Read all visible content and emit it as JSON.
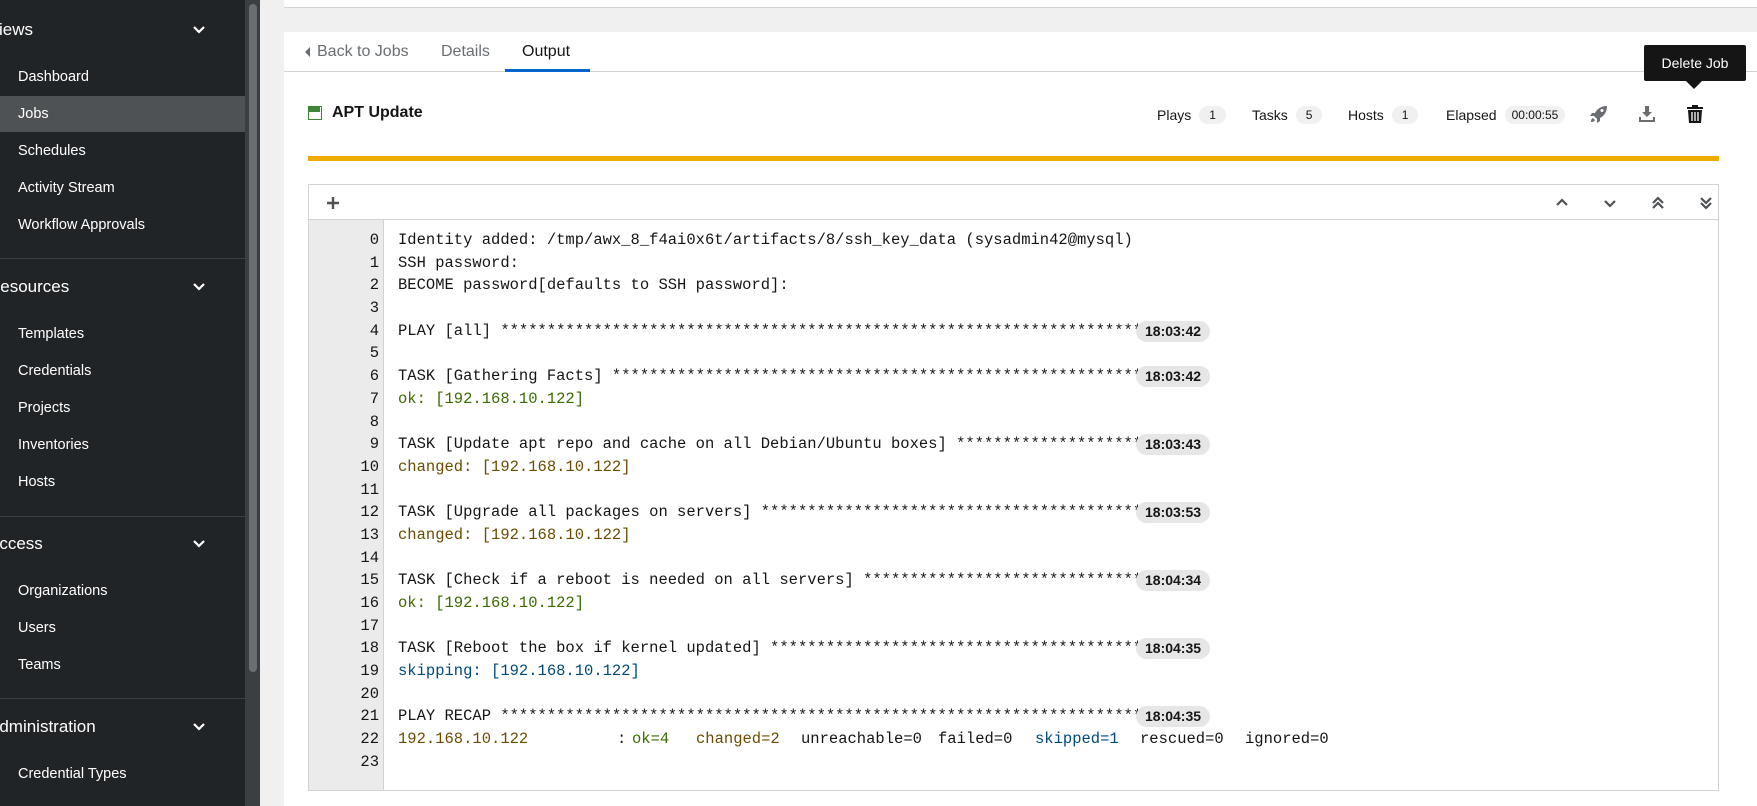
{
  "sidebar": {
    "sections": [
      {
        "title": "Views",
        "items": [
          "Dashboard",
          "Jobs",
          "Schedules",
          "Activity Stream",
          "Workflow Approvals"
        ]
      },
      {
        "title": "Resources",
        "items": [
          "Templates",
          "Credentials",
          "Projects",
          "Inventories",
          "Hosts"
        ]
      },
      {
        "title": "Access",
        "items": [
          "Organizations",
          "Users",
          "Teams"
        ]
      },
      {
        "title": "Administration",
        "items": [
          "Credential Types"
        ]
      }
    ]
  },
  "tabs": {
    "back": "Back to Jobs",
    "details": "Details",
    "output": "Output"
  },
  "tooltip": "Delete Job",
  "job": {
    "title": "APT Update",
    "status_color": "#3e8635",
    "plays_label": "Plays",
    "plays": "1",
    "tasks_label": "Tasks",
    "tasks": "5",
    "hosts_label": "Hosts",
    "hosts": "1",
    "elapsed_label": "Elapsed",
    "elapsed": "00:00:55",
    "progress_color": "#f0ab00",
    "progress_fraction": 1.0
  },
  "output": {
    "lines": [
      {
        "n": "0",
        "text": "Identity added: /tmp/awx_8_f4ai0x6t/artifacts/8/ssh_key_data (sysadmin42@mysql)",
        "kind": "plain",
        "ts": ""
      },
      {
        "n": "1",
        "text": "SSH password:",
        "kind": "plain",
        "ts": ""
      },
      {
        "n": "2",
        "text": "BECOME password[defaults to SSH password]:",
        "kind": "plain",
        "ts": ""
      },
      {
        "n": "3",
        "text": "",
        "kind": "plain",
        "ts": ""
      },
      {
        "n": "4",
        "text": "PLAY [all] *********************************************************************",
        "kind": "plain",
        "ts": "18:03:42"
      },
      {
        "n": "5",
        "text": "",
        "kind": "plain",
        "ts": ""
      },
      {
        "n": "6",
        "text": "TASK [Gathering Facts] *********************************************************",
        "kind": "plain",
        "ts": "18:03:42"
      },
      {
        "n": "7",
        "text": "ok: [192.168.10.122]",
        "kind": "ok",
        "ts": ""
      },
      {
        "n": "8",
        "text": "",
        "kind": "plain",
        "ts": ""
      },
      {
        "n": "9",
        "text": "TASK [Update apt repo and cache on all Debian/Ubuntu boxes] ********************",
        "kind": "plain",
        "ts": "18:03:43"
      },
      {
        "n": "10",
        "text": "changed: [192.168.10.122]",
        "kind": "changed",
        "ts": ""
      },
      {
        "n": "11",
        "text": "",
        "kind": "plain",
        "ts": ""
      },
      {
        "n": "12",
        "text": "TASK [Upgrade all packages on servers] *****************************************",
        "kind": "plain",
        "ts": "18:03:53"
      },
      {
        "n": "13",
        "text": "changed: [192.168.10.122]",
        "kind": "changed",
        "ts": ""
      },
      {
        "n": "14",
        "text": "",
        "kind": "plain",
        "ts": ""
      },
      {
        "n": "15",
        "text": "TASK [Check if a reboot is needed on all servers] ******************************",
        "kind": "plain",
        "ts": "18:04:34"
      },
      {
        "n": "16",
        "text": "ok: [192.168.10.122]",
        "kind": "ok",
        "ts": ""
      },
      {
        "n": "17",
        "text": "",
        "kind": "plain",
        "ts": ""
      },
      {
        "n": "18",
        "text": "TASK [Reboot the box if kernel updated] ****************************************",
        "kind": "plain",
        "ts": "18:04:35"
      },
      {
        "n": "19",
        "text": "skipping: [192.168.10.122]",
        "kind": "skip",
        "ts": ""
      },
      {
        "n": "20",
        "text": "",
        "kind": "plain",
        "ts": ""
      },
      {
        "n": "21",
        "text": "PLAY RECAP *********************************************************************",
        "kind": "plain",
        "ts": "18:04:35"
      },
      {
        "n": "22",
        "text": "",
        "kind": "recap",
        "ts": ""
      },
      {
        "n": "23",
        "text": "",
        "kind": "plain",
        "ts": ""
      }
    ],
    "recap": {
      "host": "192.168.10.122",
      "colon": ":",
      "ok": "ok=4",
      "changed": "changed=2",
      "unreachable": "unreachable=0",
      "failed": "failed=0",
      "skipped": "skipped=1",
      "rescued": "rescued=0",
      "ignored": "ignored=0"
    }
  }
}
